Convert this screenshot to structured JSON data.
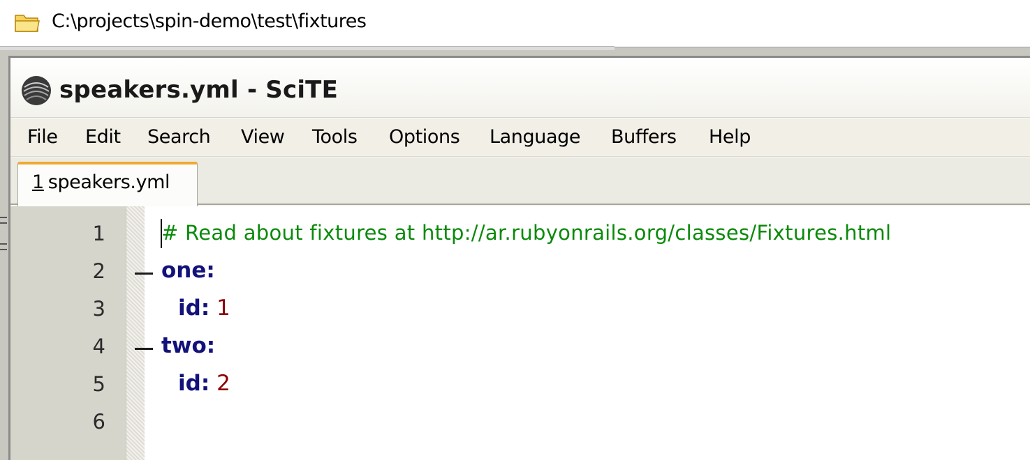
{
  "explorer": {
    "address_path": "C:\\projects\\spin-demo\\test\\fixtures",
    "folder_icon": "folder-icon"
  },
  "window": {
    "title": "speakers.yml - SciTE",
    "icon": "scite-app-icon"
  },
  "menu": {
    "items": [
      "File",
      "Edit",
      "Search",
      "View",
      "Tools",
      "Options",
      "Language",
      "Buffers",
      "Help"
    ]
  },
  "tabs": [
    {
      "number": "1",
      "label": "speakers.yml",
      "active": true
    }
  ],
  "editor": {
    "line_numbers": [
      "1",
      "2",
      "3",
      "4",
      "5",
      "6"
    ],
    "lines": [
      {
        "comment": "# Read about fixtures at http://ar.rubyonrails.org/classes/Fixtures.html"
      },
      {
        "key": "one:"
      },
      {
        "key": "id:",
        "value": "1"
      },
      {
        "key": "two:"
      },
      {
        "key": "id:",
        "value": "2"
      },
      {
        "key": ""
      }
    ]
  },
  "colors": {
    "comment": "#0a8a0a",
    "key": "#12127a",
    "number": "#8b0000",
    "tab_accent": "#f0a932"
  }
}
